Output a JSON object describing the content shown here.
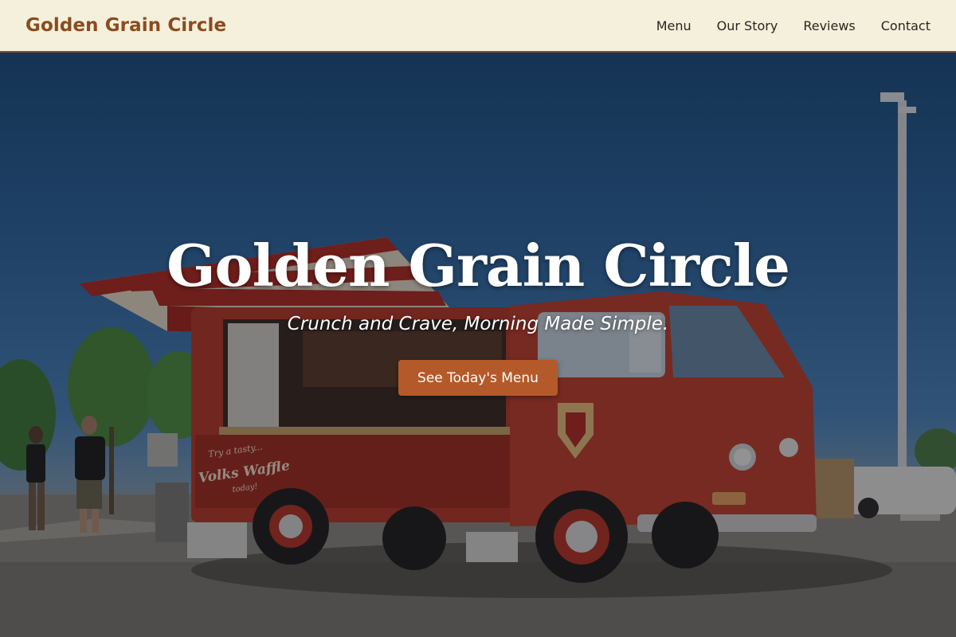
{
  "header": {
    "brand": "Golden Grain Circle",
    "nav": [
      "Menu",
      "Our Story",
      "Reviews",
      "Contact"
    ]
  },
  "hero": {
    "title": "Golden Grain Circle",
    "tagline": "Crunch and Crave, Morning Made Simple.",
    "cta_label": "See Today's Menu",
    "truck_lettering": [
      "Try a tasty...",
      "Volks Waffle",
      "today!"
    ]
  },
  "colors": {
    "header_bg": "#f5f0dc",
    "brand": "#8a4b1f",
    "accent_border": "#8a4d2a",
    "cta_bg": "#b45a2a",
    "hero_text": "#ffffff"
  }
}
